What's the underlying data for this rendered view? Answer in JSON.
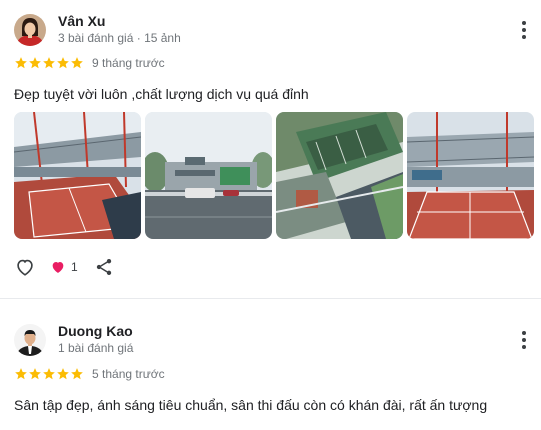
{
  "reviews": [
    {
      "author": "Vân Xu",
      "meta": "3 bài đánh giá · 15 ảnh",
      "rating": 5,
      "date": "9 tháng trước",
      "text": "Đẹp tuyệt vời luôn ,chất lượng dịch vụ quá đỉnh",
      "photos": [
        "tennis-court-aerial",
        "building-road-view",
        "complex-overview",
        "tennis-court-canopy"
      ],
      "reactions": {
        "count": "1",
        "like_icon": "heart-outline-icon",
        "react_icon": "heart-filled-icon",
        "share_icon": "share-icon"
      }
    },
    {
      "author": "Duong Kao",
      "meta": "1 bài đánh giá",
      "rating": 5,
      "date": "5 tháng trước",
      "text": "Sân tập đẹp, ánh sáng tiêu chuẩn, sân thi đấu còn có khán đài, rất ấn tượng"
    }
  ],
  "colors": {
    "star": "#fbbc04",
    "meta": "#70757a",
    "text": "#202124",
    "heart": "#e91e63"
  }
}
